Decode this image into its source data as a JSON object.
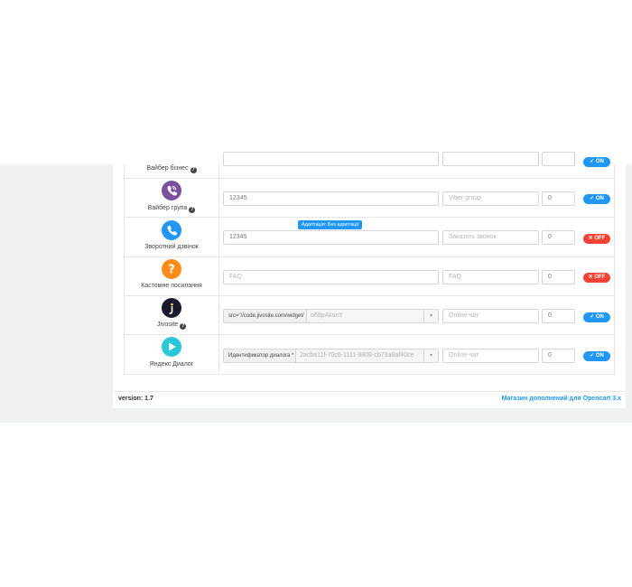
{
  "colors": {
    "on": "#2196f3",
    "off": "#f44336",
    "link": "#2196f3"
  },
  "rows": [
    {
      "label": "Вайбер бізнес",
      "has_help": true,
      "toggle": "ON",
      "icon": "viber-icon",
      "partial": true
    },
    {
      "label": "Вайбер група",
      "has_help": true,
      "icon": "viber-icon",
      "value": "12345",
      "title_placeholder": "Viber group",
      "sort": "0",
      "toggle": "ON"
    },
    {
      "label": "Зворотний дзвінок",
      "has_help": false,
      "icon": "phone-icon",
      "value": "12345",
      "title_placeholder": "Заказать звонок",
      "sort": "0",
      "toggle": "OFF",
      "tooltip": "Адаптація: Без адаптації"
    },
    {
      "label": "Кастомне посилання",
      "has_help": false,
      "icon": "question-icon",
      "value_placeholder": "FAQ",
      "title_placeholder": "FAQ",
      "sort": "0",
      "toggle": "OFF"
    },
    {
      "label": "Jivosite",
      "has_help": true,
      "icon": "jivosite-icon",
      "addon": "src=\"//code.jivosite.com/widget/",
      "value": "o69pAksnY",
      "title_placeholder": "Online-чат",
      "sort": "0",
      "toggle": "ON"
    },
    {
      "label": "Яндекс Диалог",
      "has_help": false,
      "icon": "yandex-dialog-icon",
      "addon": "Идентификатор диалога *",
      "value": "2acba11f-70c6-1111-8808-cb73a8af40ce",
      "title_placeholder": "Online-чат",
      "sort": "0",
      "toggle": "ON"
    }
  ],
  "footer": {
    "version": "version: 1.7",
    "store_link": "Магазин дополнений для Opencart 3.x"
  }
}
